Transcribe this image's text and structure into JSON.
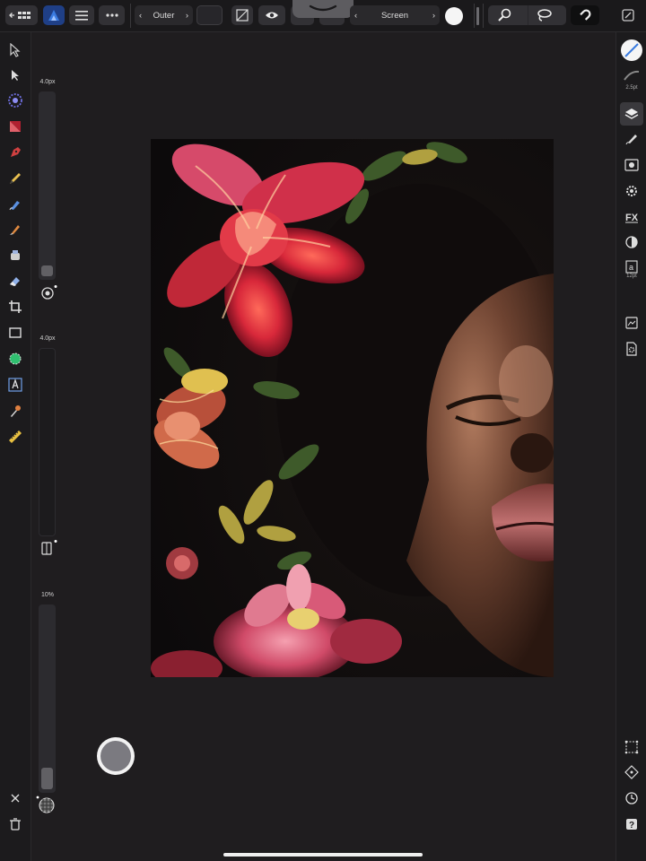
{
  "top_toolbar": {
    "effect_selector": {
      "label": "Outer"
    },
    "blend_selector": {
      "label": "Screen"
    }
  },
  "sliders": {
    "width": {
      "label": "4.0px",
      "value_fraction": 0.02
    },
    "second": {
      "label": "4.0px"
    },
    "opacity": {
      "label": "10%",
      "value_fraction": 0.1
    }
  },
  "right_panel": {
    "stroke_width_label": "2.5pt",
    "text_size_label": "12pt"
  },
  "colors": {
    "accent": "#3a7be0",
    "background": "#1f1d1f",
    "panel": "#1c1b1d"
  }
}
